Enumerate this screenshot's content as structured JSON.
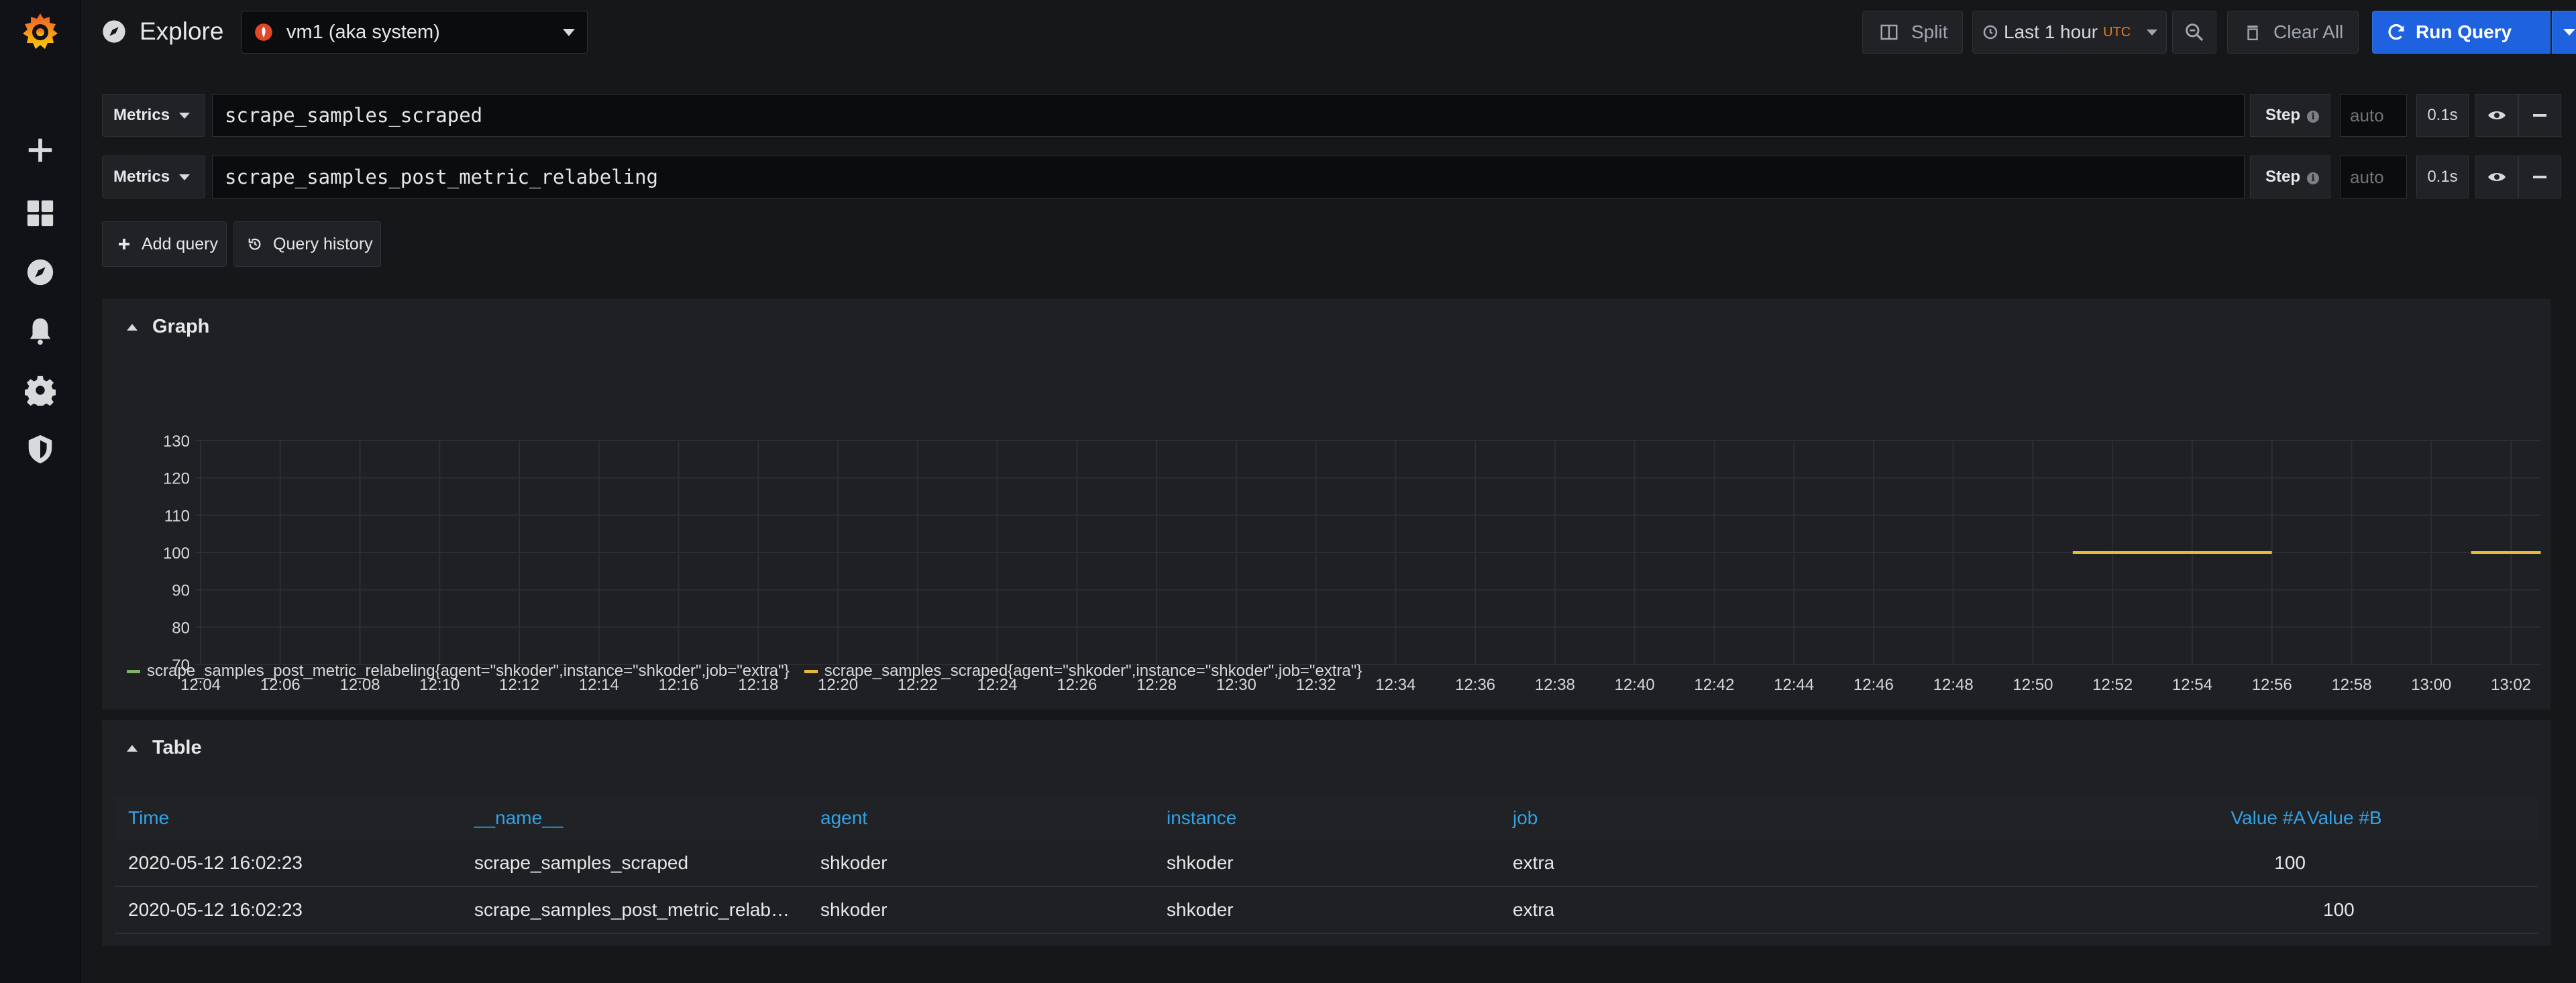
{
  "header": {
    "title": "Explore",
    "datasource": "vm1 (aka system)",
    "split_label": "Split",
    "time_range": "Last 1 hour",
    "timezone": "UTC",
    "clear_all_label": "Clear All",
    "run_query_label": "Run Query"
  },
  "queries": [
    {
      "type": "Metrics",
      "expr": "scrape_samples_scraped",
      "step_label": "Step",
      "step_placeholder": "auto",
      "interval": "0.1s"
    },
    {
      "type": "Metrics",
      "expr": "scrape_samples_post_metric_relabeling",
      "step_label": "Step",
      "step_placeholder": "auto",
      "interval": "0.1s"
    }
  ],
  "actions": {
    "add_query": "Add query",
    "query_history": "Query history"
  },
  "graph_panel": {
    "title": "Graph"
  },
  "table_panel": {
    "title": "Table"
  },
  "colors": {
    "series_a": "#7eb26d",
    "series_b": "#eab839",
    "accent": "#1f62e0",
    "link": "#33a2e5"
  },
  "chart_data": {
    "type": "line",
    "title": "Graph",
    "ylim": [
      70,
      130
    ],
    "yticks": [
      "130",
      "120",
      "110",
      "100",
      "90",
      "80",
      "70"
    ],
    "xticks": [
      "12:04",
      "12:06",
      "12:08",
      "12:10",
      "12:12",
      "12:14",
      "12:16",
      "12:18",
      "12:20",
      "12:22",
      "12:24",
      "12:26",
      "12:28",
      "12:30",
      "12:32",
      "12:34",
      "12:36",
      "12:38",
      "12:40",
      "12:42",
      "12:44",
      "12:46",
      "12:48",
      "12:50",
      "12:52",
      "12:54",
      "12:56",
      "12:58",
      "13:00",
      "13:02"
    ],
    "grid": true,
    "legend_position": "bottom-left",
    "series": [
      {
        "name": "scrape_samples_post_metric_relabeling{agent=\"shkoder\",instance=\"shkoder\",job=\"extra\"}",
        "color": "#7eb26d",
        "segments": []
      },
      {
        "name": "scrape_samples_scraped{agent=\"shkoder\",instance=\"shkoder\",job=\"extra\"}",
        "color": "#eab839",
        "segments": [
          {
            "x": [
              "12:51",
              "12:56"
            ],
            "y": [
              100,
              100
            ]
          },
          {
            "x": [
              "13:01",
              "13:02:45"
            ],
            "y": [
              100,
              100
            ]
          }
        ]
      }
    ]
  },
  "table": {
    "columns": [
      "Time",
      "__name__",
      "agent",
      "instance",
      "job",
      "Value #A",
      "Value #B"
    ],
    "rows": [
      [
        "2020-05-12 16:02:23",
        "scrape_samples_scraped",
        "shkoder",
        "shkoder",
        "extra",
        "100",
        ""
      ],
      [
        "2020-05-12 16:02:23",
        "scrape_samples_post_metric_relabeling",
        "shkoder",
        "shkoder",
        "extra",
        "",
        "100"
      ]
    ]
  }
}
